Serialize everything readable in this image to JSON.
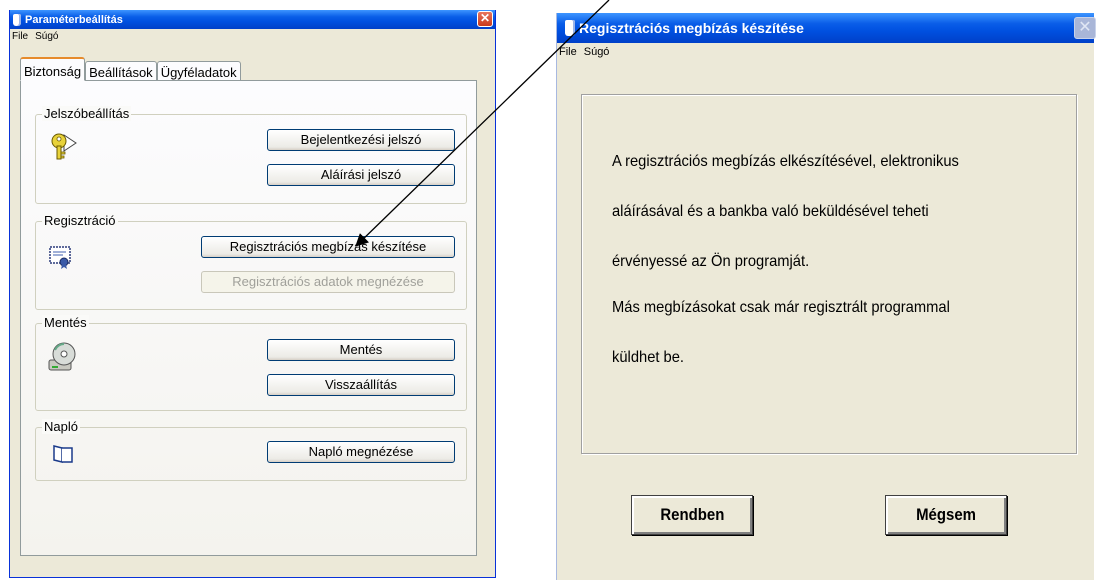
{
  "win1": {
    "title": "Paraméterbeállítás",
    "menu": [
      "File",
      "Súgó"
    ],
    "tabs": [
      "Biztonság",
      "Beállítások",
      "Ügyféladatok"
    ],
    "groups": {
      "password": {
        "legend": "Jelszóbeállítás",
        "buttons": [
          "Bejelentkezési jelszó",
          "Aláírási jelszó"
        ]
      },
      "registration": {
        "legend": "Regisztráció",
        "buttons": [
          "Regisztrációs megbízás készítése",
          "Regisztrációs adatok megnézése"
        ]
      },
      "backup": {
        "legend": "Mentés",
        "buttons": [
          "Mentés",
          "Visszaállítás"
        ]
      },
      "log": {
        "legend": "Napló",
        "buttons": [
          "Napló megnézése"
        ]
      }
    }
  },
  "win2": {
    "title": "Regisztrációs megbízás készítése",
    "menu": [
      "File",
      "Súgó"
    ],
    "lines": [
      "A regisztrációs megbízás elkészítésével, elektronikus",
      "aláírásával és a bankba való beküldésével teheti",
      "érvényessé az Ön programját.",
      "Más megbízásokat csak már regisztrált programmal",
      "küldhet be."
    ],
    "ok_label": "Rendben",
    "cancel_label": "Mégsem"
  },
  "colors": {
    "titlebar": "#0a5ee8",
    "window_bg": "#ece9d8",
    "tab_accent": "#e68b2c",
    "close": "#c83a1c"
  }
}
